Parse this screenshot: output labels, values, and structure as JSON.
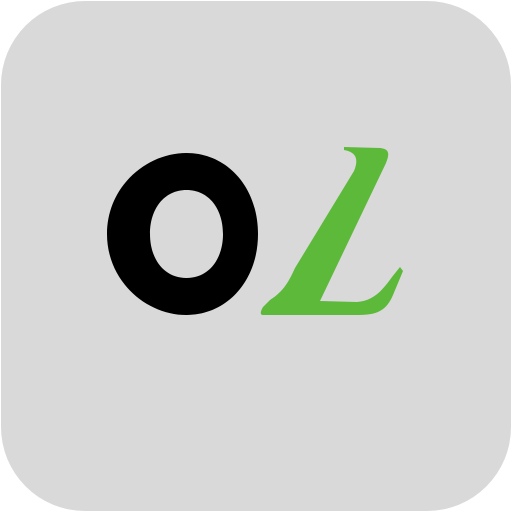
{
  "icon": {
    "background_color": "#d9d9d9",
    "logo_text": "OL",
    "letter_o_color": "#000000",
    "letter_l_color": "#5db93a"
  }
}
